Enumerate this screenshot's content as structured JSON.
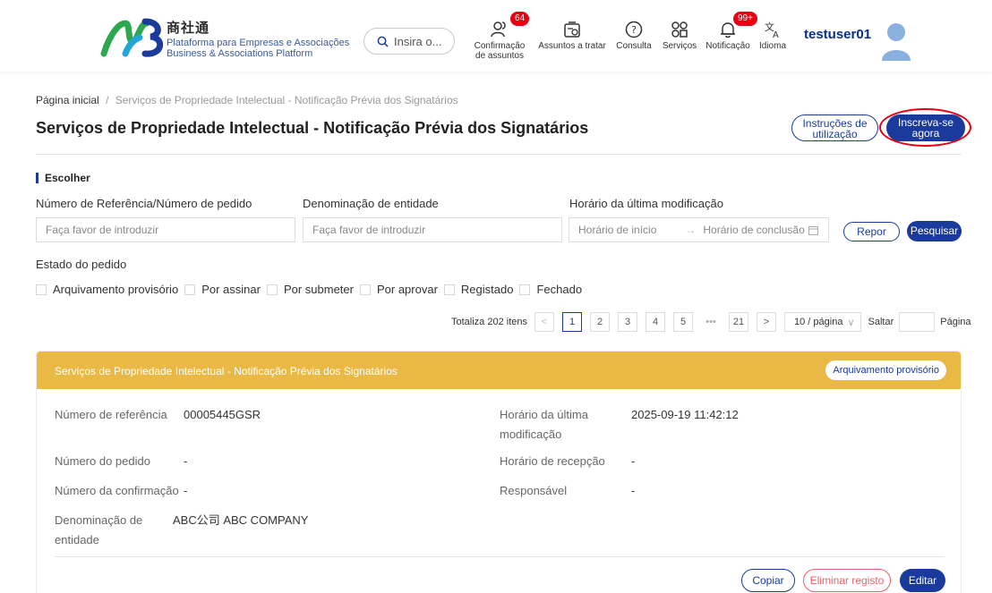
{
  "header": {
    "logo_cn": "商社通",
    "logo_pt": "Plataforma para Empresas e Associações",
    "logo_en": "Business & Associations Platform",
    "search_placeholder": "Insira o...",
    "nav": [
      {
        "label1": "Confirmação",
        "label2": "de assuntos",
        "badge": "64",
        "icon": "users-icon"
      },
      {
        "label1": "Assuntos a tratar",
        "label2": "",
        "badge": "",
        "icon": "task-icon"
      },
      {
        "label1": "Consulta",
        "label2": "",
        "badge": "",
        "icon": "help-icon"
      },
      {
        "label1": "Serviços",
        "label2": "",
        "badge": "",
        "icon": "services-icon"
      },
      {
        "label1": "Notificação",
        "label2": "",
        "badge": "99+",
        "icon": "bell-icon"
      },
      {
        "label1": "Idioma",
        "label2": "",
        "badge": "",
        "icon": "language-icon"
      }
    ],
    "username": "testuser01"
  },
  "breadcrumb": {
    "home": "Página inicial",
    "separator": "/",
    "current": "Serviços de Propriedade Intelectual - Notificação Prévia dos Signatários"
  },
  "page": {
    "title": "Serviços de Propriedade Intelectual - Notificação Prévia dos Signatários",
    "instructions_l1": "Instruções de",
    "instructions_l2": "utilização",
    "subscribe_l1": "Inscreva-se",
    "subscribe_l2": "agora"
  },
  "filter": {
    "section": "Escolher",
    "ref_label": "Número de Referência/Número de pedido",
    "ref_placeholder": "Faça favor de introduzir",
    "entity_label": "Denominação de entidade",
    "entity_placeholder": "Faça favor de introduzir",
    "time_label": "Horário da última modificação",
    "start_placeholder": "Horário de início",
    "end_placeholder": "Horário de conclusão",
    "reset": "Repor",
    "search": "Pesquisar",
    "status_label": "Estado do pedido",
    "statuses": [
      "Arquivamento provisório",
      "Por assinar",
      "Por submeter",
      "Por aprovar",
      "Registado",
      "Fechado"
    ]
  },
  "pagination": {
    "total": "Totaliza 202 itens",
    "pages": [
      "1",
      "2",
      "3",
      "4",
      "5",
      "•••",
      "21"
    ],
    "page_size": "10 / página",
    "jump": "Saltar",
    "page_word": "Página"
  },
  "card": {
    "title": "Serviços de Propriedade Intelectual - Notificação Prévia dos Signatários",
    "status": "Arquivamento provisório",
    "ref_label": "Número de referência",
    "ref_value": "00005445GSR",
    "modified_label_l1": "Horário da última",
    "modified_label_l2": "modificação",
    "modified_value": "2025-09-19 11:42:12",
    "order_label": "Número do pedido",
    "order_value": "-",
    "received_label": "Horário de recepção",
    "received_value": "-",
    "confirm_label": "Número da confirmação",
    "confirm_value": "-",
    "owner_label": "Responsável",
    "owner_value": "-",
    "entity_label_l1": "Denominação de",
    "entity_label_l2": "entidade",
    "entity_value": "ABC公司 ABC COMPANY",
    "copy": "Copiar",
    "delete": "Eliminar registo",
    "edit": "Editar"
  },
  "colors": {
    "brand": "#1a3a9c",
    "card_header": "#eab845",
    "badge": "#e60012",
    "danger": "#e8626b"
  }
}
